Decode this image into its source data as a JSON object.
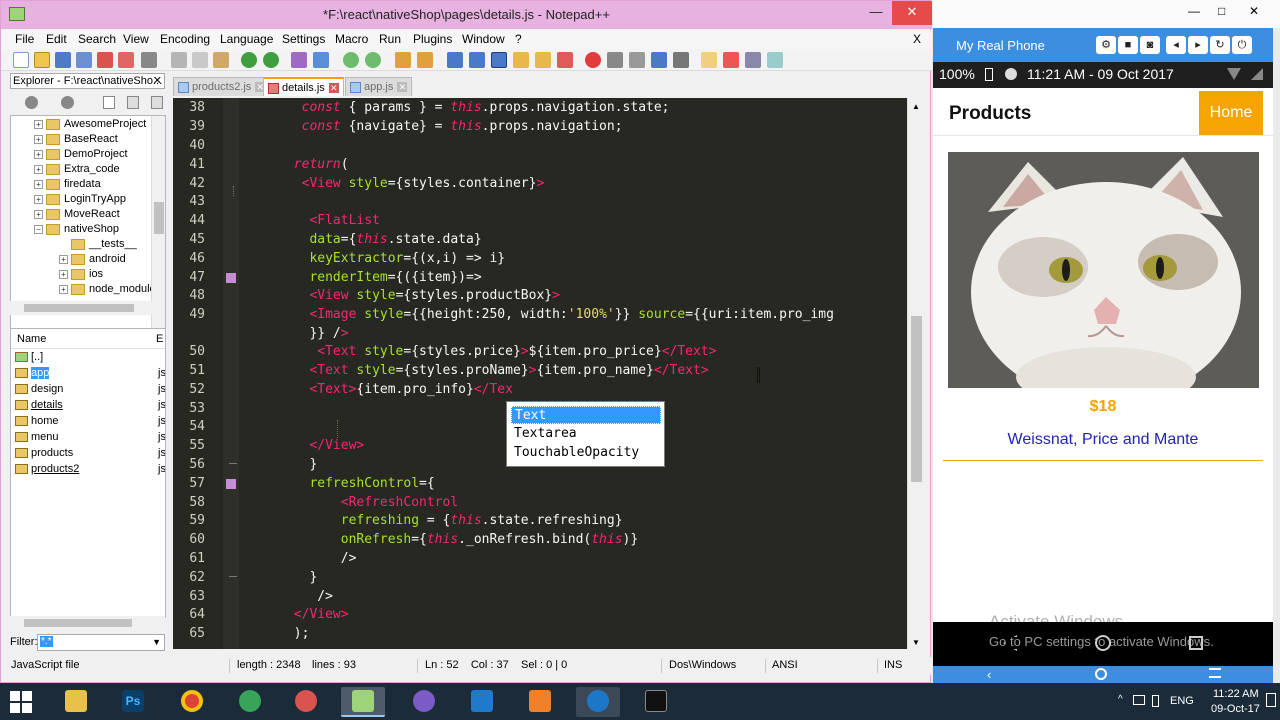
{
  "window": {
    "title": "*F:\\react\\nativeShop\\pages\\details.js - Notepad++",
    "minimize": "—",
    "maximize": "□",
    "close": "✕",
    "close_doc": "X"
  },
  "menu": [
    "File",
    "Edit",
    "Search",
    "View",
    "Encoding",
    "Language",
    "Settings",
    "Macro",
    "Run",
    "Plugins",
    "Window",
    "?"
  ],
  "explorer": {
    "title": "Explorer - F:\\react\\nativeSho...",
    "close": "✕",
    "tree": [
      {
        "label": "AwesomeProject",
        "expander": "+"
      },
      {
        "label": "BaseReact",
        "expander": "+"
      },
      {
        "label": "DemoProject",
        "expander": "+"
      },
      {
        "label": "Extra_code",
        "expander": "+"
      },
      {
        "label": "firedata",
        "expander": "+"
      },
      {
        "label": "LoginTryApp",
        "expander": "+"
      },
      {
        "label": "MoveReact",
        "expander": "+"
      },
      {
        "label": "nativeShop",
        "expander": "−"
      },
      {
        "label": "__tests__",
        "expander": ""
      },
      {
        "label": "android",
        "expander": "+"
      },
      {
        "label": "ios",
        "expander": "+"
      },
      {
        "label": "node_modules",
        "expander": "+"
      }
    ],
    "list_header": {
      "name": "Name",
      "ext": "E"
    },
    "files": [
      {
        "name": "[..]",
        "ext": ""
      },
      {
        "name": "app",
        "ext": "js"
      },
      {
        "name": "design",
        "ext": "js"
      },
      {
        "name": "details",
        "ext": "js"
      },
      {
        "name": "home",
        "ext": "js"
      },
      {
        "name": "menu",
        "ext": "js"
      },
      {
        "name": "products",
        "ext": "js"
      },
      {
        "name": "products2",
        "ext": "js"
      }
    ],
    "filter_label": "Filter:",
    "filter_value": "*.*"
  },
  "tabs": [
    {
      "label": "products2.js",
      "close": "✕"
    },
    {
      "label": "details.js",
      "close": "✕"
    },
    {
      "label": "app.js",
      "close": "✕"
    }
  ],
  "line_numbers": [
    "38",
    "39",
    "40",
    "41",
    "42",
    "43",
    "44",
    "45",
    "46",
    "47",
    "48",
    "49",
    "",
    "50",
    "51",
    "52",
    "53",
    "54",
    "55",
    "56",
    "57",
    "58",
    "59",
    "60",
    "61",
    "62",
    "63",
    "64",
    "65"
  ],
  "autocomplete": [
    "Text",
    "Textarea",
    "TouchableOpacity"
  ],
  "status": {
    "type": "JavaScript file",
    "length": "length : 2348",
    "lines": "lines : 93",
    "position": "Ln : 52    Col : 37    Sel : 0 | 0",
    "eol": "Dos\\Windows",
    "encoding": "ANSI",
    "mode": "INS"
  },
  "phone": {
    "device": "My Real Phone",
    "status": "100%",
    "time": "11:21 AM - 09 Oct 2017",
    "controls": [
      "⚙",
      "■",
      "◙",
      "◂",
      "▸",
      "↻",
      "⏻"
    ],
    "app_title": "Products",
    "home_button": "Home",
    "price": "$18",
    "product_name": "Weissnat, Price and Mante",
    "watermark": "Activate Windows",
    "watermark_sub": "Go to PC settings to activate Windows."
  },
  "taskbar": {
    "lang": "ENG",
    "time": "11:22 AM",
    "date": "09-Oct-17"
  }
}
